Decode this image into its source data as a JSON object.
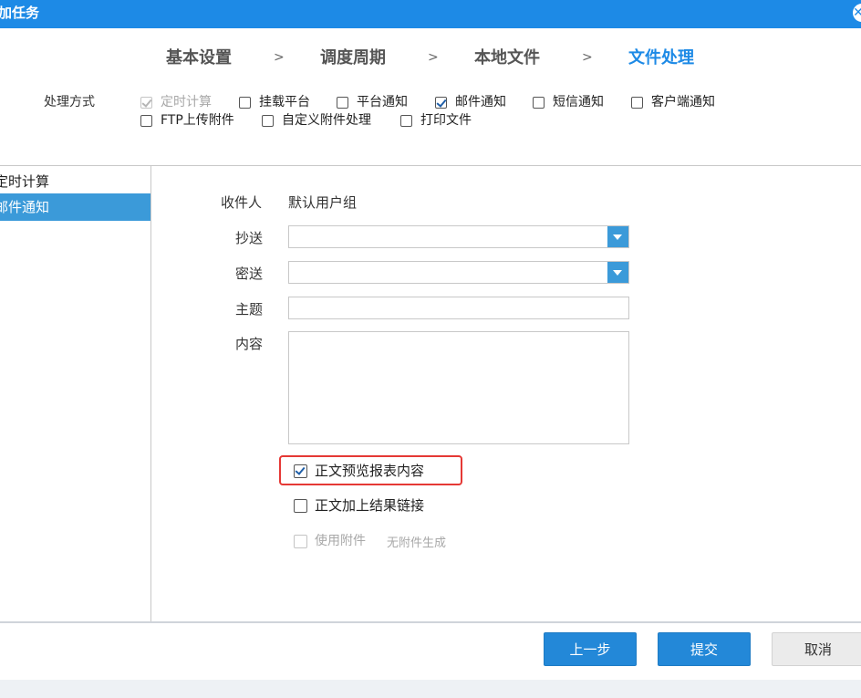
{
  "dialog": {
    "title": "加任务",
    "close_icon": "close-icon"
  },
  "steps": [
    {
      "label": "基本设置",
      "active": false
    },
    {
      "label": "调度周期",
      "active": false
    },
    {
      "label": "本地文件",
      "active": false
    },
    {
      "label": "文件处理",
      "active": true
    }
  ],
  "step_separator": ">",
  "process": {
    "label": "处理方式",
    "options": [
      {
        "label": "定时计算",
        "checked": true,
        "disabled": true
      },
      {
        "label": "挂载平台",
        "checked": false,
        "disabled": false
      },
      {
        "label": "平台通知",
        "checked": false,
        "disabled": false
      },
      {
        "label": "邮件通知",
        "checked": true,
        "disabled": false
      },
      {
        "label": "短信通知",
        "checked": false,
        "disabled": false
      },
      {
        "label": "客户端通知",
        "checked": false,
        "disabled": false
      },
      {
        "label": "FTP上传附件",
        "checked": false,
        "disabled": false
      },
      {
        "label": "自定义附件处理",
        "checked": false,
        "disabled": false
      },
      {
        "label": "打印文件",
        "checked": false,
        "disabled": false
      }
    ]
  },
  "sidebar": {
    "items": [
      {
        "label": "定时计算",
        "selected": false
      },
      {
        "label": "邮件通知",
        "selected": true
      }
    ]
  },
  "form": {
    "recipient_label": "收件人",
    "recipient_value": "默认用户组",
    "cc_label": "抄送",
    "cc_value": "",
    "bcc_label": "密送",
    "bcc_value": "",
    "subject_label": "主题",
    "subject_value": "",
    "content_label": "内容",
    "content_value": "",
    "preview_label": "正文预览报表内容",
    "preview_checked": true,
    "link_label": "正文加上结果链接",
    "link_checked": false,
    "attach_label": "使用附件",
    "attach_checked": false,
    "attach_disabled": true,
    "attach_note": "无附件生成"
  },
  "footer": {
    "prev_label": "上一步",
    "submit_label": "提交",
    "cancel_label": "取消"
  },
  "colors": {
    "accent": "#1d8ae6",
    "selected_bg": "#3b9ad9",
    "highlight_border": "#e53935"
  }
}
